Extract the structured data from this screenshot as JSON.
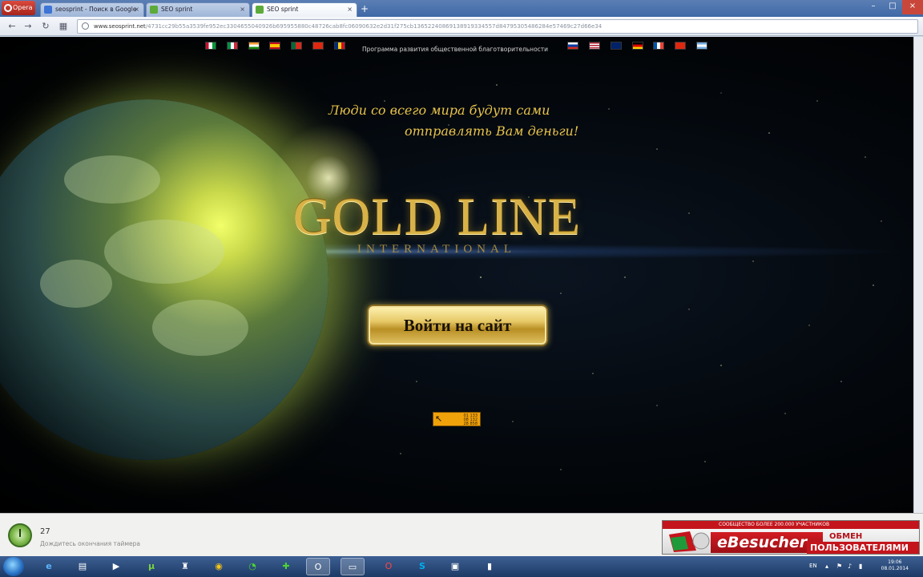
{
  "browser": {
    "menu_label": "Opera",
    "tabs": [
      {
        "label": "seosprint - Поиск в Google",
        "active": false
      },
      {
        "label": "SEO sprint",
        "active": false
      },
      {
        "label": "SEO sprint",
        "active": true
      }
    ],
    "new_tab_label": "+",
    "url_host": "www.seosprint.net",
    "url_path": "/4731cc29b55a3539fe952ec3304655040926b695955880c48726cab8fc06090632e2d31f275cb13652240869138919334557d84795305486284e57469c27d66e34"
  },
  "page": {
    "program_text": "Программа развития общественной благотворительности",
    "slogan_line1": "Люди со всего мира будут сами",
    "slogan_line2": "отправлять Вам деньги!",
    "logo_main": "GOLD LINE",
    "logo_sub": "INTERNATIONAL",
    "enter_button": "Войти на сайт",
    "counter_values": [
      "01 133",
      "08 132",
      "28 858"
    ],
    "flags_left": [
      "ae",
      "it",
      "in",
      "es",
      "pt",
      "cn",
      "ro"
    ],
    "flags_right": [
      "ru",
      "us",
      "gb",
      "de",
      "fr",
      "cn",
      "ar"
    ]
  },
  "infobar": {
    "timer_value": "27",
    "timer_text": "Дождитесь окончания таймера"
  },
  "ad": {
    "strip_text": "СООБЩЕСТВО БОЛЕЕ 200.000 УЧАСТНИКОВ",
    "brand": "eBesucher",
    "line1": "ОБМЕН",
    "line2": "ПОЛЬЗОВАТЕЛЯМИ"
  },
  "taskbar": {
    "lang": "EN",
    "time": "19:06",
    "date": "08.01.2014"
  },
  "colors": {
    "gold": "#d9b247",
    "slogan": "#e8c34a",
    "counter": "#f0a20b"
  }
}
